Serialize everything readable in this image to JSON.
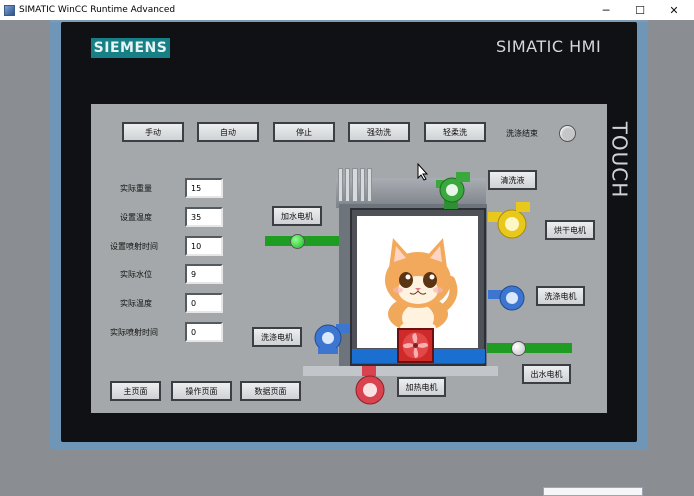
{
  "window": {
    "title": "SIMATIC WinCC Runtime Advanced",
    "minimize": "─",
    "maximize": "☐",
    "close": "✕"
  },
  "panel": {
    "brand": "SIEMENS",
    "model": "SIMATIC HMI",
    "touch": "TOUCH"
  },
  "modes": {
    "manual": "手动",
    "auto": "自动",
    "stop": "停止",
    "strong_wash": "强劲洗",
    "gentle_wash": "轻柔洗",
    "wash_end": "洗涤结束"
  },
  "params": [
    {
      "label": "实际重量",
      "value": "15"
    },
    {
      "label": "设置温度",
      "value": "35"
    },
    {
      "label": "设置喷射时间",
      "value": "10"
    },
    {
      "label": "实际水位",
      "value": "9"
    },
    {
      "label": "实际温度",
      "value": "0"
    },
    {
      "label": "实际喷射时间",
      "value": "0"
    }
  ],
  "equipment": {
    "add_water_motor": "加水电机",
    "detergent": "清洗液",
    "dryer_motor": "烘干电机",
    "wash_motor_right": "洗涤电机",
    "wash_motor_left": "洗涤电机",
    "heat_motor": "加热电机",
    "drain_motor": "出水电机"
  },
  "nav": {
    "home": "主页面",
    "operation": "操作页面",
    "data": "数据页面"
  },
  "colors": {
    "brand": "#168086",
    "active_button": "#2fbf34",
    "pipe": "#1f9c22",
    "water": "#1a6fd0",
    "pump_green": "#3ba83e",
    "pump_yellow": "#e8c81a",
    "pump_blue": "#3d76d1",
    "pump_red": "#d8434f"
  },
  "icons": {
    "pointer": "mouse-pointer-icon",
    "fan": "heater-fan-icon",
    "cat": "cat-image"
  }
}
